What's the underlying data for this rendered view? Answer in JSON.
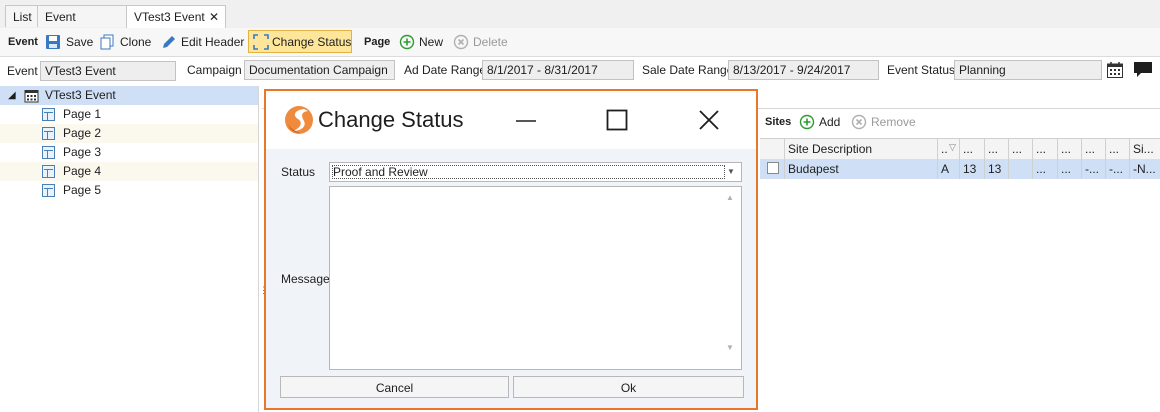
{
  "tabs": [
    {
      "label": "List"
    },
    {
      "label": "Event Calendar"
    },
    {
      "label": "VTest3 Event",
      "close": "✕"
    }
  ],
  "toolbar": {
    "event_section": "Event",
    "save": "Save",
    "clone": "Clone",
    "edit_header": "Edit Header",
    "change_status": "Change Status",
    "page_section": "Page",
    "new": "New",
    "delete": "Delete"
  },
  "header": {
    "event_label": "Event",
    "event_value": "VTest3 Event",
    "campaign_label": "Campaign",
    "campaign_value": "Documentation Campaign",
    "ad_date_label": "Ad Date Range",
    "ad_date_value": "8/1/2017 - 8/31/2017",
    "sale_date_label": "Sale Date Range",
    "sale_date_value": "8/13/2017 - 9/24/2017",
    "status_label": "Event Status",
    "status_value": "Planning"
  },
  "tree": {
    "root": "VTest3 Event",
    "pages": [
      "Page 1",
      "Page 2",
      "Page 3",
      "Page 4",
      "Page 5"
    ]
  },
  "sites": {
    "section": "Sites",
    "add": "Add",
    "remove": "Remove",
    "columns": [
      "Site Description",
      "..",
      "...",
      "...",
      "...",
      "...",
      "...",
      "...",
      "...",
      "Si..."
    ],
    "row": [
      "Budapest",
      "A",
      "13",
      "13",
      "",
      "...",
      "...",
      "-...",
      "-...",
      "-N..."
    ]
  },
  "modal": {
    "title": "Change Status",
    "status_label": "Status",
    "status_value": "Proof and Review",
    "message_label": "Message",
    "message_value": "",
    "cancel": "Cancel",
    "ok": "Ok"
  },
  "colors": {
    "accent_orange": "#e8772b",
    "selection_blue": "#cfe0f6",
    "active_button": "#fde59a",
    "add_green": "#2e9b2e"
  }
}
